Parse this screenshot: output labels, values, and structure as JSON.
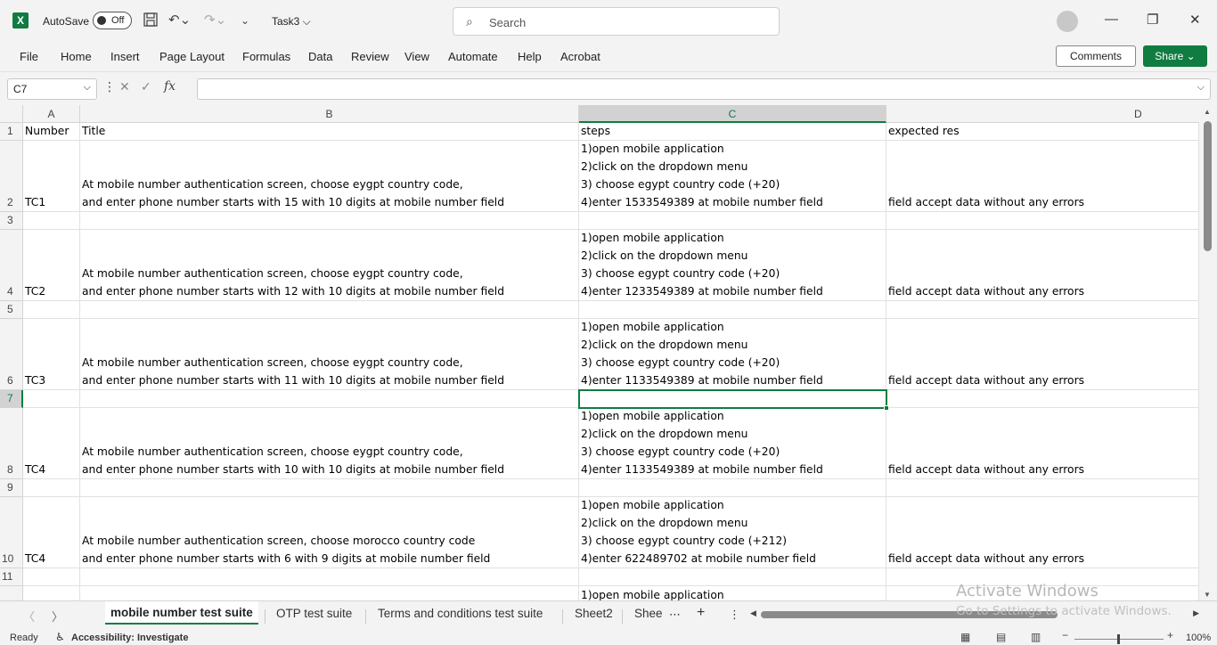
{
  "app": {
    "autosave_label": "AutoSave",
    "autosave_state": "Off",
    "doc_title": "Task3 ⌵",
    "search_placeholder": "Search",
    "brand_color": "#107c41"
  },
  "menu": [
    "File",
    "Home",
    "Insert",
    "Page Layout",
    "Formulas",
    "Data",
    "Review",
    "View",
    "Automate",
    "Help",
    "Acrobat"
  ],
  "buttons": {
    "comments": "Comments",
    "share": "Share ⌄"
  },
  "formula_bar": {
    "name_box": "C7",
    "fx": "fx",
    "value": ""
  },
  "columns": [
    "A",
    "B",
    "C",
    "D"
  ],
  "selected_column": "C",
  "rows": [
    {
      "num": "1",
      "a": "Number",
      "b": "Title",
      "c": "steps",
      "d": "expected res"
    },
    {
      "num": "2",
      "a": "TC1",
      "b": "At mobile number authentication screen, choose eygpt country code,\nand enter phone number starts with 15 with 10 digits at mobile number field",
      "c": "1)open mobile application\n2)click on the dropdown menu\n3) choose egypt country code (+20)\n4)enter 1533549389 at mobile number field",
      "d": "field accept data without any errors"
    },
    {
      "num": "3",
      "a": "",
      "b": "",
      "c": "",
      "d": ""
    },
    {
      "num": "4",
      "a": "TC2",
      "b": "At mobile number authentication screen, choose eygpt country code,\nand enter phone number starts with 12 with 10 digits at mobile number field",
      "c": "1)open mobile application\n2)click on the dropdown menu\n3) choose egypt country code (+20)\n4)enter 1233549389 at mobile number field",
      "d": "field accept data without any errors"
    },
    {
      "num": "5",
      "a": "",
      "b": "",
      "c": "",
      "d": ""
    },
    {
      "num": "6",
      "a": "TC3",
      "b": "At mobile number authentication screen, choose eygpt country code,\nand enter phone number starts with 11 with 10 digits at mobile number field",
      "c": "1)open mobile application\n2)click on the dropdown menu\n3) choose egypt country code (+20)\n4)enter 1133549389 at mobile number field",
      "d": "field accept data without any errors"
    },
    {
      "num": "7",
      "a": "",
      "b": "",
      "c": "",
      "d": ""
    },
    {
      "num": "8",
      "a": "TC4",
      "b": "At mobile number authentication screen, choose eygpt country code,\nand enter phone number starts with 10 with 10 digits at mobile number field",
      "c": "1)open mobile application\n2)click on the dropdown menu\n3) choose egypt country code (+20)\n4)enter 1133549389 at mobile number field",
      "d": "field accept data without any errors"
    },
    {
      "num": "9",
      "a": "",
      "b": "",
      "c": "",
      "d": ""
    },
    {
      "num": "10",
      "a": "TC4",
      "b": "At mobile number authentication screen, choose morocco country code\nand enter phone number starts with 6 with 9 digits at mobile number field",
      "c": "1)open mobile application\n2)click on the dropdown menu\n3) choose egypt country code (+212)\n4)enter 622489702 at mobile number field",
      "d": "field accept data without any errors"
    },
    {
      "num": "11",
      "a": "",
      "b": "",
      "c": "",
      "d": ""
    },
    {
      "num": "",
      "a": "",
      "b": "",
      "c": "1)open mobile application",
      "d": ""
    }
  ],
  "selected_row": "7",
  "sheets": [
    "mobile number test suite",
    "OTP test suite",
    "Terms and conditions test suite",
    "Sheet2",
    "Shee"
  ],
  "active_sheet": "mobile number test suite",
  "watermark": {
    "line1": "Activate Windows",
    "line2": "Go to Settings to activate Windows."
  },
  "status": {
    "ready": "Ready",
    "accessibility": "Accessibility: Investigate",
    "zoom": "100%"
  }
}
